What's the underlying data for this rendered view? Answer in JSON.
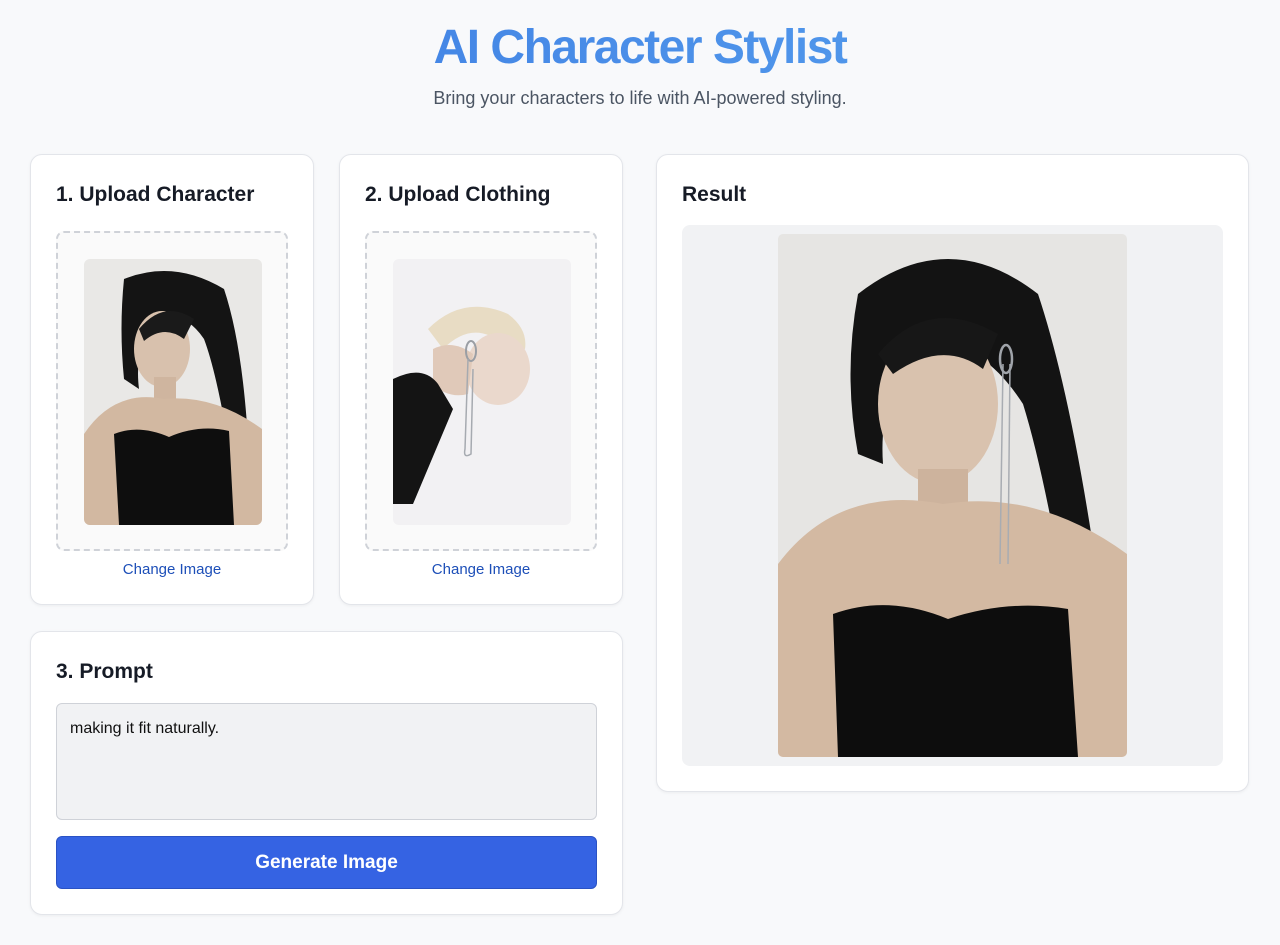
{
  "header": {
    "title": "AI Character Stylist",
    "subtitle": "Bring your characters to life with AI-powered styling."
  },
  "character": {
    "title": "1. Upload Character",
    "change_label": "Change Image",
    "image_alt": "Character photo: woman with long black hair in black strapless top"
  },
  "clothing": {
    "title": "2. Upload Clothing",
    "change_label": "Change Image",
    "image_alt": "Clothing reference: silver ear cuff with chain earring"
  },
  "prompt": {
    "title": "3. Prompt",
    "value": "making it fit naturally.",
    "button_label": "Generate Image"
  },
  "result": {
    "title": "Result",
    "image_alt": "Generated image: character wearing silver ear cuff with chain"
  },
  "colors": {
    "accent": "#3563e3",
    "title_gradient_start": "#3a78e0",
    "title_gradient_end": "#5aa5ef",
    "link": "#1d4fb8"
  }
}
